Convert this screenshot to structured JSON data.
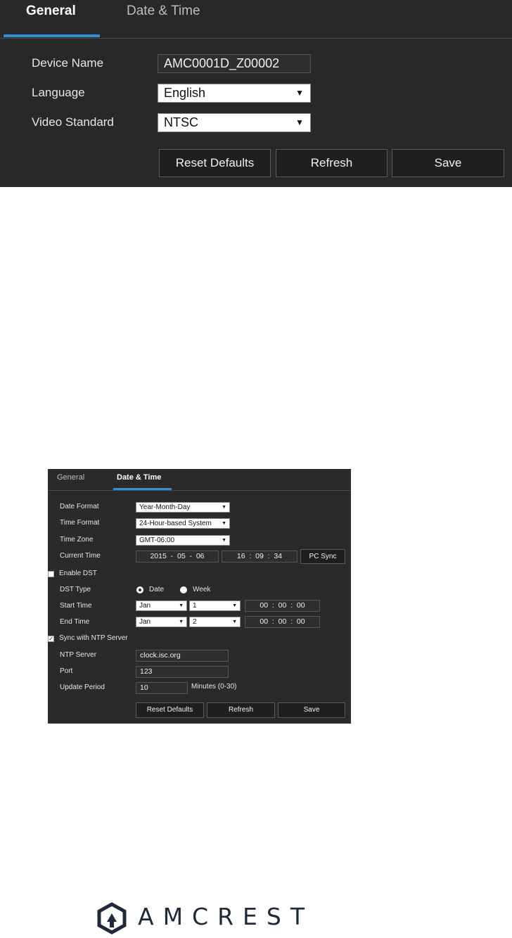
{
  "general_panel": {
    "tabs": [
      "General",
      "Date & Time"
    ],
    "device_name_label": "Device Name",
    "device_name_value": "AMC0001D_Z00002",
    "language_label": "Language",
    "language_value": "English",
    "video_standard_label": "Video Standard",
    "video_standard_value": "NTSC",
    "buttons": [
      "Reset Defaults",
      "Refresh",
      "Save"
    ]
  },
  "datetime_panel": {
    "tabs": [
      "General",
      "Date & Time"
    ],
    "date_format_label": "Date Format",
    "date_format_value": "Year-Month-Day",
    "time_format_label": "Time Format",
    "time_format_value": "24-Hour-based System",
    "time_zone_label": "Time Zone",
    "time_zone_value": "GMT-06:00",
    "current_time_label": "Current Time",
    "current_date": "2015  -  05  -  06",
    "current_clock": "16  :  09  :  34",
    "pc_sync_label": "PC Sync",
    "enable_dst_label": "Enable DST",
    "dst_type_label": "DST Type",
    "dst_option_date": "Date",
    "dst_option_week": "Week",
    "start_time_label": "Start Time",
    "start_month": "Jan",
    "start_day": "1",
    "start_clock": "00  :  00  :  00",
    "end_time_label": "End Time",
    "end_month": "Jan",
    "end_day": "2",
    "end_clock": "00  :  00  :  00",
    "ntp_sync_label": "Sync with NTP Server",
    "ntp_server_label": "NTP Server",
    "ntp_server_value": "clock.isc.org",
    "port_label": "Port",
    "port_value": "123",
    "update_period_label": "Update Period",
    "update_period_value": "10",
    "update_period_unit": "Minutes (0-30)",
    "buttons": [
      "Reset Defaults",
      "Refresh",
      "Save"
    ]
  },
  "logo": {
    "text": "AMCREST",
    "color": "#1e2a3a"
  },
  "colors": {
    "accent": "#2d8fd6",
    "panel_bg": "#282828"
  }
}
